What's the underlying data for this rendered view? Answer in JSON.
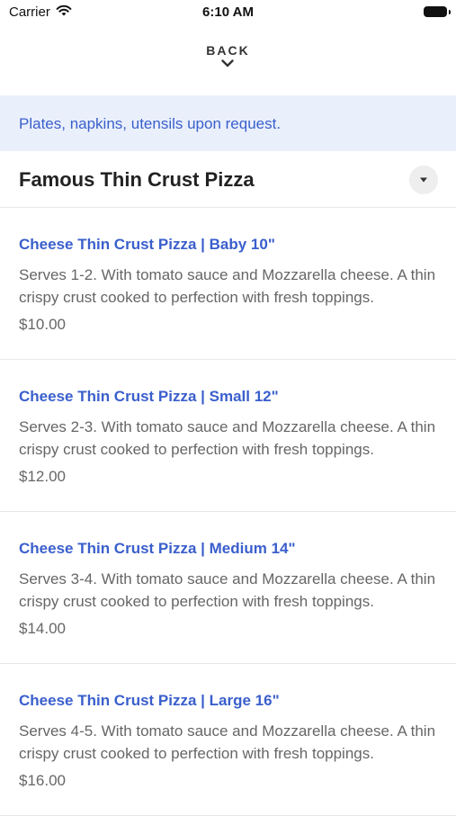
{
  "status_bar": {
    "carrier": "Carrier",
    "time": "6:10 AM"
  },
  "nav": {
    "back_label": "BACK"
  },
  "notice": {
    "text": "Plates, napkins, utensils upon request."
  },
  "section": {
    "title": "Famous Thin Crust Pizza"
  },
  "items": [
    {
      "name": "Cheese Thin Crust Pizza | Baby 10\"",
      "description": "Serves 1-2. With tomato sauce and Mozzarella cheese. A thin crispy crust cooked to perfection with fresh toppings.",
      "price": "$10.00"
    },
    {
      "name": "Cheese Thin Crust Pizza | Small 12\"",
      "description": "Serves 2-3. With tomato sauce and Mozzarella cheese. A thin crispy crust cooked to perfection with fresh toppings.",
      "price": "$12.00"
    },
    {
      "name": "Cheese Thin Crust Pizza | Medium 14\"",
      "description": "Serves 3-4. With tomato sauce and Mozzarella cheese. A thin crispy crust cooked to perfection with fresh toppings.",
      "price": "$14.00"
    },
    {
      "name": "Cheese Thin Crust Pizza | Large 16\"",
      "description": "Serves 4-5. With tomato sauce and Mozzarella cheese. A thin crispy crust cooked to perfection with fresh toppings.",
      "price": "$16.00"
    }
  ],
  "colors": {
    "accent": "#3a5fcc",
    "notice_bg": "#eaf0fb"
  },
  "icons": {
    "signal": "wifi-icon",
    "battery": "battery-icon",
    "back": "chevron-down-icon",
    "dropdown": "caret-down-icon"
  }
}
